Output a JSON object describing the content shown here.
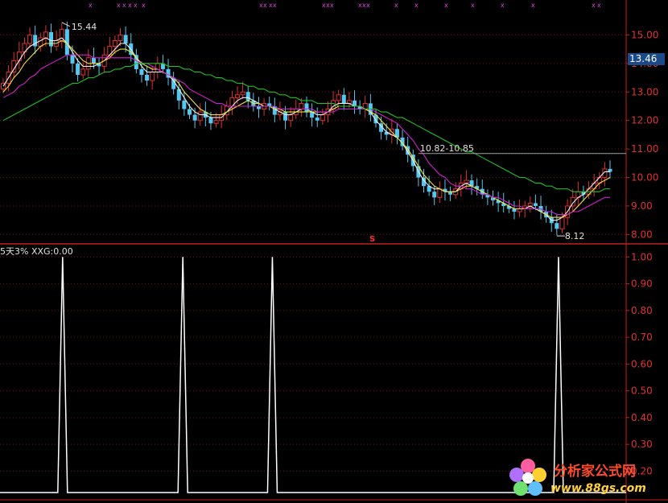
{
  "chart_data": [
    {
      "type": "candlestick",
      "panel": "price",
      "ylim": [
        7.7,
        16.0
      ],
      "yticks": [
        8.0,
        9.0,
        10.0,
        11.0,
        12.0,
        13.0,
        14.0,
        15.0
      ],
      "ytick_labels": [
        "8.00",
        "9.00",
        "10.00",
        "11.00",
        "12.00",
        "13.00",
        "14.00",
        "15.00"
      ],
      "current_price": "13.46",
      "current_price_value": 13.46,
      "annotations": {
        "high": {
          "label": "15.44",
          "value": 15.44
        },
        "low": {
          "label": "8.12",
          "value": 8.12
        },
        "range": {
          "label": "10.82-10.85",
          "value": 10.84
        },
        "marker": "S"
      },
      "close_series": [
        13.3,
        13.7,
        14.1,
        14.4,
        14.7,
        15.0,
        14.6,
        14.9,
        15.1,
        14.6,
        14.8,
        15.2,
        14.3,
        14.0,
        13.6,
        13.8,
        14.2,
        14.0,
        13.9,
        14.3,
        14.6,
        14.8,
        15.0,
        14.7,
        14.3,
        13.8,
        13.6,
        13.4,
        13.7,
        14.0,
        13.8,
        13.5,
        13.1,
        12.7,
        12.4,
        12.2,
        12.0,
        12.3,
        12.1,
        11.9,
        12.0,
        12.2,
        12.5,
        12.8,
        12.9,
        13.0,
        12.7,
        12.5,
        12.4,
        12.6,
        12.5,
        12.2,
        12.3,
        12.0,
        12.2,
        12.4,
        12.6,
        12.3,
        12.1,
        12.0,
        12.2,
        12.4,
        12.7,
        12.9,
        12.6,
        12.7,
        12.5,
        12.4,
        12.6,
        12.2,
        11.9,
        11.6,
        11.5,
        11.7,
        11.4,
        11.1,
        10.8,
        10.4,
        10.0,
        9.7,
        9.5,
        9.3,
        9.6,
        9.5,
        9.4,
        9.6,
        9.8,
        9.9,
        9.7,
        9.6,
        9.4,
        9.3,
        9.2,
        9.1,
        9.0,
        8.9,
        8.8,
        8.9,
        9.0,
        9.1,
        9.0,
        8.8,
        8.6,
        8.4,
        8.2,
        8.6,
        9.0,
        9.3,
        9.5,
        9.4,
        9.6,
        9.8,
        10.0,
        10.3,
        10.2
      ],
      "ma_series": [
        {
          "color": "#f0f0f0",
          "values": [
            13.2,
            13.5,
            13.8,
            14.1,
            14.4,
            14.6,
            14.7,
            14.8,
            14.9,
            14.8,
            14.8,
            14.9,
            14.7,
            14.4,
            14.1,
            13.9,
            13.9,
            13.9,
            14.0,
            14.1,
            14.3,
            14.5,
            14.7,
            14.7,
            14.5,
            14.2,
            13.9,
            13.7,
            13.7,
            13.7,
            13.7,
            13.6,
            13.4,
            13.1,
            12.8,
            12.5,
            12.3,
            12.2,
            12.2,
            12.1,
            12.1,
            12.1,
            12.3,
            12.5,
            12.7,
            12.8,
            12.8,
            12.7,
            12.6,
            12.5,
            12.5,
            12.4,
            12.3,
            12.2,
            12.2,
            12.3,
            12.4,
            12.4,
            12.3,
            12.2,
            12.2,
            12.3,
            12.5,
            12.6,
            12.6,
            12.6,
            12.5,
            12.5,
            12.4,
            12.3,
            12.0,
            11.8,
            11.6,
            11.5,
            11.4,
            11.2,
            10.9,
            10.6,
            10.2,
            9.9,
            9.7,
            9.6,
            9.6,
            9.5,
            9.5,
            9.5,
            9.7,
            9.8,
            9.7,
            9.6,
            9.5,
            9.4,
            9.3,
            9.2,
            9.1,
            9.0,
            8.9,
            8.9,
            8.9,
            9.0,
            8.9,
            8.8,
            8.7,
            8.5,
            8.5,
            8.6,
            8.8,
            9.1,
            9.3,
            9.4,
            9.6,
            9.8,
            10.0,
            10.2,
            10.2
          ]
        },
        {
          "color": "#f0e040",
          "values": [
            13.0,
            13.2,
            13.5,
            13.7,
            14.0,
            14.2,
            14.4,
            14.6,
            14.7,
            14.7,
            14.7,
            14.8,
            14.7,
            14.5,
            14.3,
            14.1,
            14.0,
            14.0,
            14.0,
            14.1,
            14.2,
            14.4,
            14.5,
            14.5,
            14.4,
            14.2,
            14.0,
            13.9,
            13.8,
            13.8,
            13.7,
            13.6,
            13.5,
            13.3,
            13.0,
            12.8,
            12.6,
            12.4,
            12.3,
            12.2,
            12.2,
            12.2,
            12.3,
            12.4,
            12.5,
            12.6,
            12.7,
            12.6,
            12.6,
            12.5,
            12.5,
            12.4,
            12.4,
            12.3,
            12.3,
            12.3,
            12.3,
            12.3,
            12.3,
            12.3,
            12.3,
            12.3,
            12.4,
            12.5,
            12.5,
            12.5,
            12.5,
            12.5,
            12.4,
            12.3,
            12.2,
            12.0,
            11.8,
            11.6,
            11.4,
            11.2,
            11.0,
            10.7,
            10.4,
            10.1,
            9.9,
            9.7,
            9.6,
            9.5,
            9.5,
            9.5,
            9.6,
            9.7,
            9.7,
            9.6,
            9.5,
            9.4,
            9.3,
            9.2,
            9.1,
            9.0,
            8.9,
            8.9,
            8.9,
            8.9,
            8.9,
            8.8,
            8.7,
            8.6,
            8.6,
            8.6,
            8.7,
            8.8,
            9.0,
            9.2,
            9.4,
            9.6,
            9.8,
            9.9,
            10.0
          ]
        },
        {
          "color": "#d020d0",
          "values": [
            12.8,
            12.9,
            13.0,
            13.2,
            13.3,
            13.5,
            13.6,
            13.8,
            13.9,
            14.0,
            14.1,
            14.2,
            14.3,
            14.3,
            14.3,
            14.3,
            14.3,
            14.2,
            14.2,
            14.2,
            14.2,
            14.2,
            14.2,
            14.2,
            14.2,
            14.1,
            14.0,
            14.0,
            13.9,
            13.8,
            13.7,
            13.6,
            13.5,
            13.4,
            13.3,
            13.1,
            13.0,
            12.9,
            12.8,
            12.7,
            12.6,
            12.6,
            12.5,
            12.5,
            12.5,
            12.5,
            12.5,
            12.5,
            12.5,
            12.5,
            12.5,
            12.5,
            12.4,
            12.4,
            12.4,
            12.4,
            12.4,
            12.4,
            12.4,
            12.3,
            12.3,
            12.3,
            12.3,
            12.4,
            12.4,
            12.4,
            12.4,
            12.4,
            12.4,
            12.4,
            12.3,
            12.2,
            12.1,
            12.0,
            11.9,
            11.7,
            11.5,
            11.3,
            11.0,
            10.8,
            10.5,
            10.3,
            10.1,
            10.0,
            9.8,
            9.7,
            9.7,
            9.6,
            9.6,
            9.5,
            9.4,
            9.4,
            9.3,
            9.3,
            9.2,
            9.1,
            9.0,
            9.0,
            8.9,
            8.9,
            8.9,
            8.9,
            8.8,
            8.8,
            8.7,
            8.7,
            8.7,
            8.8,
            8.8,
            8.9,
            9.0,
            9.1,
            9.2,
            9.3,
            9.3
          ]
        },
        {
          "color": "#20c020",
          "values": [
            12.0,
            12.1,
            12.2,
            12.3,
            12.4,
            12.5,
            12.6,
            12.7,
            12.8,
            12.9,
            13.0,
            13.1,
            13.2,
            13.3,
            13.3,
            13.4,
            13.5,
            13.5,
            13.6,
            13.7,
            13.7,
            13.8,
            13.8,
            13.9,
            13.9,
            14.0,
            14.0,
            14.0,
            14.0,
            14.0,
            14.0,
            13.9,
            13.9,
            13.9,
            13.8,
            13.8,
            13.7,
            13.7,
            13.6,
            13.6,
            13.5,
            13.5,
            13.4,
            13.4,
            13.3,
            13.3,
            13.2,
            13.2,
            13.1,
            13.1,
            13.0,
            13.0,
            12.9,
            12.9,
            12.8,
            12.8,
            12.7,
            12.7,
            12.7,
            12.6,
            12.6,
            12.6,
            12.6,
            12.5,
            12.5,
            12.5,
            12.5,
            12.5,
            12.4,
            12.4,
            12.4,
            12.3,
            12.3,
            12.2,
            12.1,
            12.1,
            12.0,
            11.9,
            11.8,
            11.7,
            11.6,
            11.5,
            11.4,
            11.3,
            11.2,
            11.1,
            11.0,
            10.9,
            10.9,
            10.8,
            10.7,
            10.6,
            10.5,
            10.4,
            10.3,
            10.2,
            10.1,
            10.0,
            10.0,
            9.9,
            9.8,
            9.8,
            9.7,
            9.7,
            9.6,
            9.6,
            9.6,
            9.5,
            9.5,
            9.5,
            9.5,
            9.5,
            9.5,
            9.6,
            9.6
          ]
        }
      ]
    },
    {
      "type": "line",
      "panel": "indicator",
      "label": "5天3%  XXG:0.00",
      "ylim": [
        0.12,
        1.04
      ],
      "yticks": [
        0.2,
        0.3,
        0.4,
        0.5,
        0.6,
        0.7,
        0.8,
        0.9,
        1.0
      ],
      "ytick_labels": [
        "0.20",
        "0.30",
        "0.40",
        "0.50",
        "0.60",
        "0.70",
        "0.80",
        "0.90",
        "1.00"
      ],
      "spike_x_fractions": [
        0.1,
        0.292,
        0.435,
        0.892
      ],
      "spike_value": 1.0,
      "base_value": 0.0
    }
  ],
  "watermark": {
    "title": "分析家公式网",
    "url": "www.88gs.com"
  },
  "colors": {
    "up": "#e03232",
    "down": "#54c8f0",
    "axis": "#c02020",
    "background": "#000000"
  }
}
